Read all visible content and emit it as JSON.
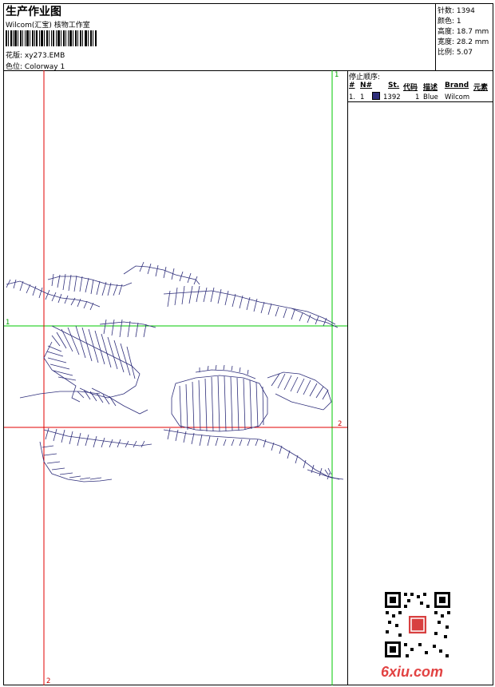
{
  "header": {
    "title": "生产作业图",
    "company": "Wilcom(汇宝) 核物工作室",
    "pattern_label": "花版:",
    "pattern_value": "xy273.EMB",
    "color_label": "色位:",
    "color_value": "Colorway 1"
  },
  "stats": {
    "stitches": "针数: 1394",
    "colors": "颜色: 1",
    "height": "高度: 18.7 mm",
    "width": "宽度: 28.2 mm",
    "ratio": "比例: 5.07"
  },
  "stop_sequence": {
    "title": "停止顺序:",
    "headers": [
      "#",
      "N#",
      "St.",
      "代码",
      "描述",
      "Brand",
      "元素"
    ],
    "rows": [
      {
        "num": "1.",
        "needle": "1",
        "stitches": "1392",
        "code": "1",
        "desc": "Blue",
        "brand": "Wilcom"
      }
    ],
    "swatch_color": "#2e2e7a"
  },
  "canvas": {
    "guide_labels": [
      "1",
      "1",
      "2",
      "2"
    ],
    "guide_color_green": "#00c800",
    "guide_color_red": "#e00000",
    "stitch_color": "#2e2e7a"
  },
  "footer": {
    "brand": "6xiu.com"
  }
}
